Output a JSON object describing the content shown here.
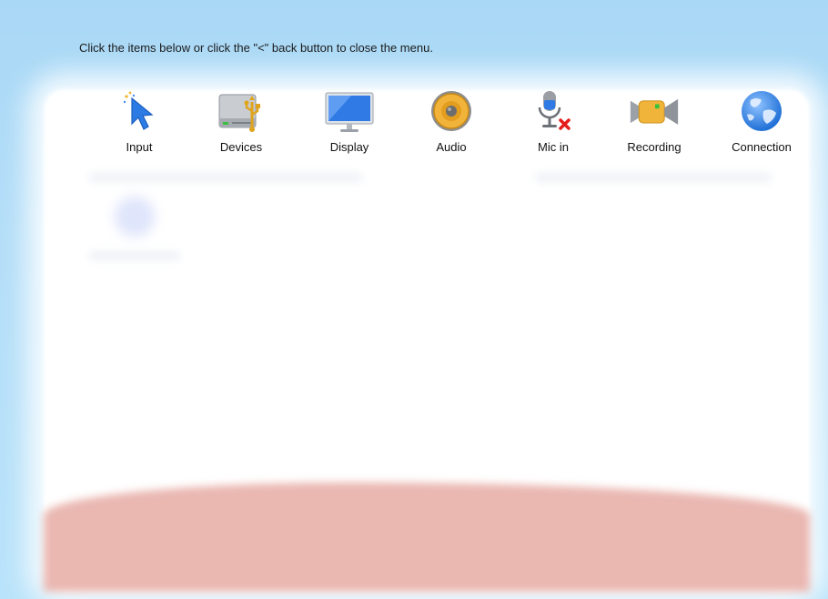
{
  "instruction": "Click the items below or click the \"<\" back button to close the menu.",
  "menu": {
    "items": [
      {
        "label": "Input",
        "icon": "cursor-arrow-icon"
      },
      {
        "label": "Devices",
        "icon": "usb-drive-icon"
      },
      {
        "label": "Display",
        "icon": "monitor-icon"
      },
      {
        "label": "Audio",
        "icon": "speaker-icon"
      },
      {
        "label": "Mic in",
        "icon": "microphone-muted-icon"
      },
      {
        "label": "Recording",
        "icon": "video-camera-icon"
      },
      {
        "label": "Connection",
        "icon": "globe-icon"
      }
    ]
  }
}
